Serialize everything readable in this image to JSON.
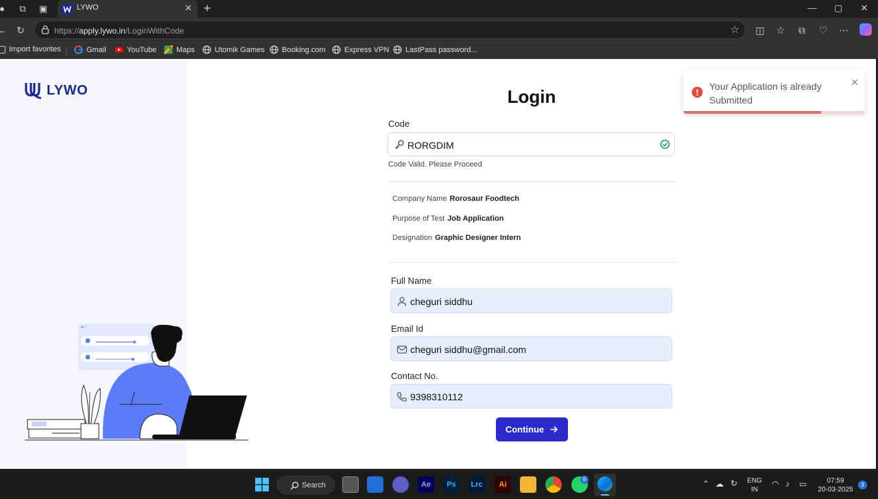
{
  "browser": {
    "tab_title": "LYWO",
    "url_prefix": "https://",
    "url_host": "apply.lywo.in",
    "url_path": "/LoginWithCode",
    "bookmarks": [
      "Import favorites",
      "Gmail",
      "YouTube",
      "Maps",
      "Utomik Games",
      "Booking.com",
      "Express VPN",
      "LastPass password..."
    ]
  },
  "brand": {
    "logo_text": "LYWO",
    "color": "#1c2a8a"
  },
  "login": {
    "title": "Login",
    "code_label": "Code",
    "code_value": "RORGDIM",
    "code_hint": "Code Valid. Please Proceed",
    "company_label": "Company Name",
    "company_value": "Rorosaur Foodtech",
    "purpose_label": "Purpose of Test",
    "purpose_value": "Job Application",
    "designation_label": "Designation",
    "designation_value": "Graphic Designer Intern",
    "fullname_label": "Full Name",
    "fullname_value": "cheguri siddhu",
    "email_label": "Email Id",
    "email_value": "cheguri siddhu@gmail.com",
    "contact_label": "Contact No.",
    "contact_value": "9398310112",
    "continue_label": "Continue",
    "accent": "#2b2bc7"
  },
  "toast": {
    "message": "Your Application is already Submitted",
    "progress": 0.76,
    "color": "#d9534f"
  },
  "taskbar": {
    "search_label": "Search",
    "lang_line1": "ENG",
    "lang_line2": "IN",
    "time": "07:59",
    "date": "20-03-2025",
    "whatsapp_badge": "9",
    "notification_count": "3"
  }
}
